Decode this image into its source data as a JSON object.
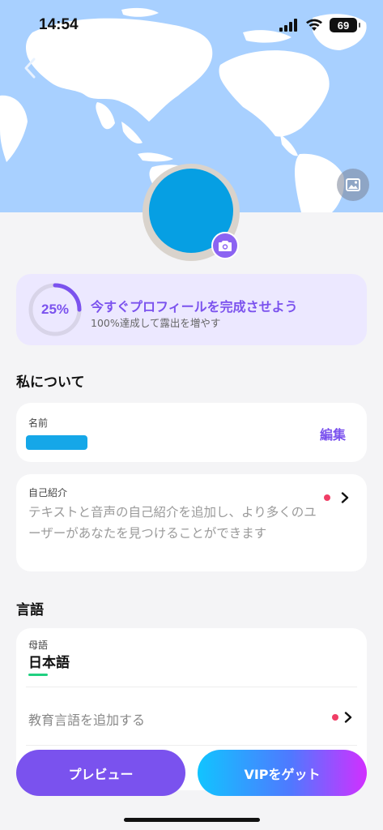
{
  "status": {
    "time": "14:54",
    "battery": "69"
  },
  "profile": {
    "progress_percent": 25,
    "progress_label": "25%",
    "progress_title": "今すぐプロフィールを完成させよう",
    "progress_subtitle": "100%達成して露出を増やす"
  },
  "about": {
    "section_title": "私について",
    "name_label": "名前",
    "edit_label": "編集",
    "intro_label": "自己紹介",
    "intro_placeholder": "テキストと音声の自己紹介を追加し、より多くのユーザーがあなたを見つけることができます"
  },
  "language": {
    "section_title": "言語",
    "native_label": "母語",
    "native_value": "日本語",
    "add_learning": "教育言語を追加する"
  },
  "actions": {
    "preview": "プレビュー",
    "vip": "VIPをゲット"
  },
  "colors": {
    "accent": "#7b52ee",
    "map_water": "#a8d0ff",
    "dot": "#f03e66",
    "avatar": "#069fe3"
  }
}
